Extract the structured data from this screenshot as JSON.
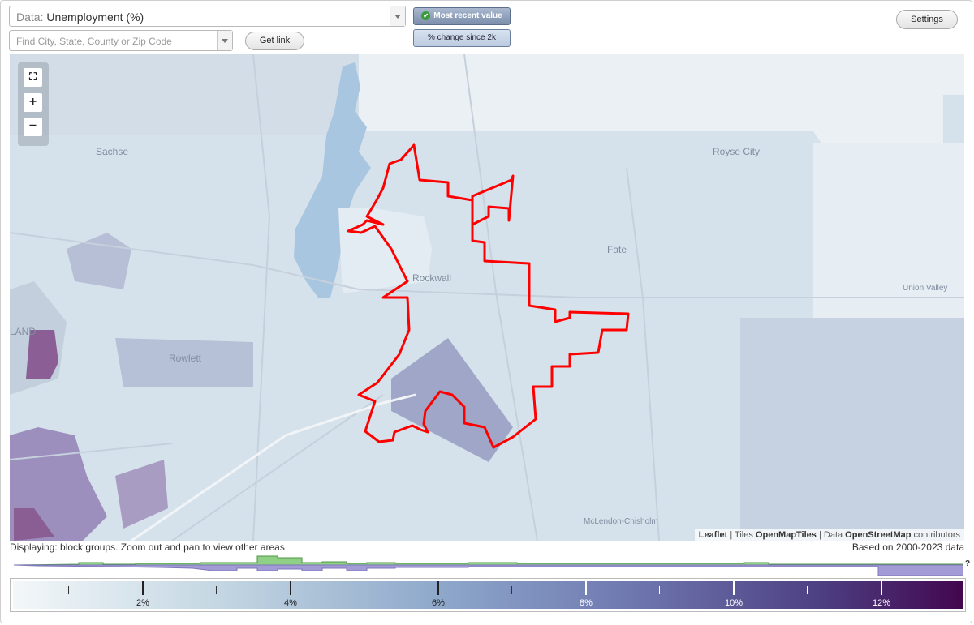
{
  "controls": {
    "data_label": "Data:",
    "data_value": "Unemployment (%)",
    "search_placeholder": "Find City, State, County or Zip Code",
    "get_link": "Get link",
    "toggle_recent": "Most recent value",
    "toggle_change": "% change since 2k",
    "settings": "Settings"
  },
  "map": {
    "places": [
      "Sachse",
      "Royse City",
      "Fate",
      "Rockwall",
      "Rowlett",
      "Union Valley",
      "McLendon-Chisholm",
      "LAND"
    ],
    "attribution": {
      "leaflet": "Leaflet",
      "sep1": " | Tiles ",
      "tiles": "OpenMapTiles",
      "sep2": " | Data ",
      "data": "OpenStreetMap",
      "contrib": " contributors"
    },
    "highlight_color": "#ff0000"
  },
  "status": "Displaying: block groups. Zoom out and pan to view other areas",
  "based_on": "Based on 2000-2023 data",
  "histogram": {
    "question_mark": "?",
    "colors": {
      "green": "#8fcf86",
      "purple": "#a29bd6"
    }
  },
  "legend": {
    "labels": [
      "2%",
      "4%",
      "6%",
      "8%",
      "10%",
      "12%"
    ],
    "colors": [
      "#f3f7f9",
      "#c3d6e2",
      "#8ea8cb",
      "#6f78b0",
      "#4d3f82",
      "#43064f"
    ]
  },
  "icons": [
    "fullscreen-icon",
    "zoom-in-icon",
    "zoom-out-icon",
    "check-icon",
    "dropdown-icon"
  ]
}
